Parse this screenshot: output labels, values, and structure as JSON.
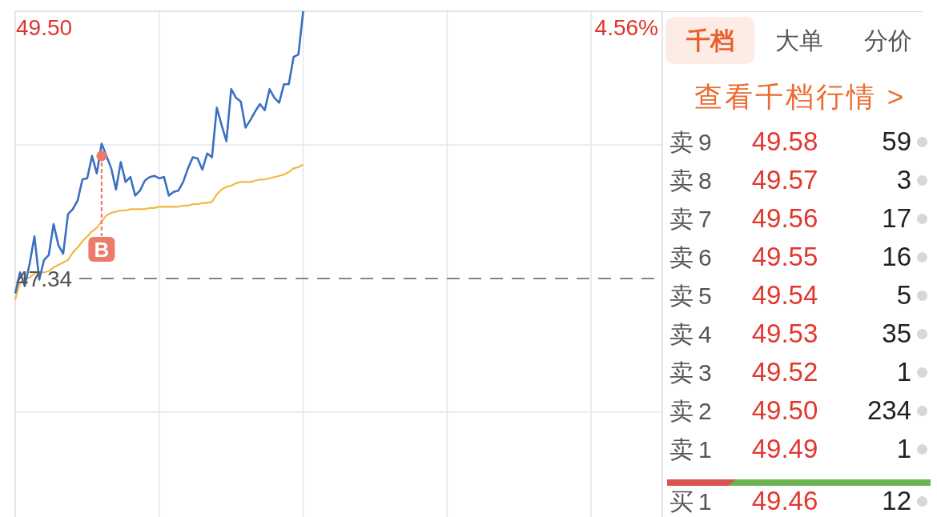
{
  "chart": {
    "top_price_label": "49.50",
    "change_label": "4.56%",
    "base_label": "47.34",
    "marker_label": "B"
  },
  "depth_panel": {
    "tabs": [
      {
        "label": "千档",
        "selected": true
      },
      {
        "label": "大单",
        "selected": false
      },
      {
        "label": "分价",
        "selected": false
      }
    ],
    "link": "查看千档行情 >",
    "asks": [
      {
        "label": "卖9",
        "price": "49.58",
        "volume": "59"
      },
      {
        "label": "卖8",
        "price": "49.57",
        "volume": "3"
      },
      {
        "label": "卖7",
        "price": "49.56",
        "volume": "17"
      },
      {
        "label": "卖6",
        "price": "49.55",
        "volume": "16"
      },
      {
        "label": "卖5",
        "price": "49.54",
        "volume": "5"
      },
      {
        "label": "卖4",
        "price": "49.53",
        "volume": "35"
      },
      {
        "label": "卖3",
        "price": "49.52",
        "volume": "1"
      },
      {
        "label": "卖2",
        "price": "49.50",
        "volume": "234"
      },
      {
        "label": "卖1",
        "price": "49.49",
        "volume": "1"
      }
    ],
    "ratio_bar": {
      "level": 0.26
    },
    "bids": [
      {
        "label": "买1",
        "price": "49.46",
        "volume": "12"
      }
    ]
  }
}
